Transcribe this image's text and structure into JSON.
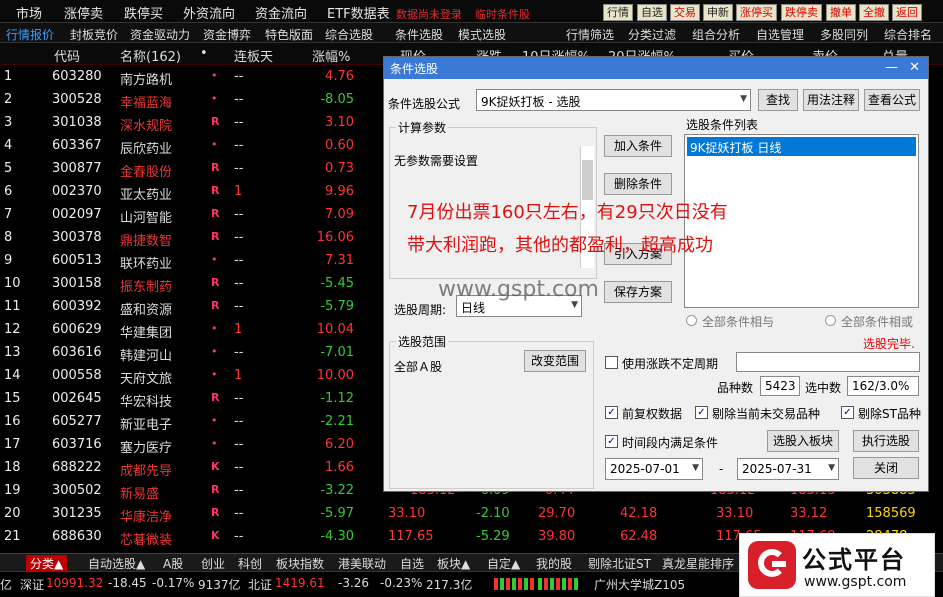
{
  "menubar": {
    "items": [
      "市场",
      "涨停卖",
      "跌停买",
      "外资流向",
      "资金流向",
      "ETF数据表"
    ],
    "login_hint": "数据尚未登录",
    "condition_hint": "临时条件股",
    "buttons": [
      "行情",
      "自选",
      "交易",
      "申新",
      "涨停买",
      "跌停卖",
      "撤单",
      "全撤",
      "返回"
    ]
  },
  "tabs": [
    "行情报价",
    "封板竞价",
    "资金驱动力",
    "资金博弈",
    "特色版面",
    "综合选股",
    "条件选股",
    "模式选股",
    "行情筛选",
    "分类过滤",
    "组合分析",
    "自选管理",
    "多股同列",
    "综合排名"
  ],
  "table": {
    "headers": [
      "代码",
      "名称(162)",
      "•",
      "连板天",
      "涨幅%",
      "现价",
      "涨跌",
      "10日涨幅%",
      "20日涨幅%",
      "买价",
      "卖价",
      "总量"
    ],
    "rows": [
      {
        "i": "1",
        "code": "603280",
        "name": "南方路机",
        "red": false,
        "mk": "•",
        "lb": "--",
        "pct": "4.76",
        "up": true
      },
      {
        "i": "2",
        "code": "300528",
        "name": "幸福蓝海",
        "red": true,
        "mk": "•",
        "lb": "--",
        "pct": "-8.05",
        "up": false
      },
      {
        "i": "3",
        "code": "301038",
        "name": "深水规院",
        "red": true,
        "mk": "R",
        "lb": "--",
        "pct": "3.10",
        "up": true
      },
      {
        "i": "4",
        "code": "603367",
        "name": "辰欣药业",
        "red": false,
        "mk": "•",
        "lb": "--",
        "pct": "0.60",
        "up": true
      },
      {
        "i": "5",
        "code": "300877",
        "name": "金春股份",
        "red": true,
        "mk": "R",
        "lb": "--",
        "pct": "0.73",
        "up": true
      },
      {
        "i": "6",
        "code": "002370",
        "name": "亚太药业",
        "red": false,
        "mk": "R",
        "lb": "1",
        "pct": "9.96",
        "up": true
      },
      {
        "i": "7",
        "code": "002097",
        "name": "山河智能",
        "red": false,
        "mk": "R",
        "lb": "--",
        "pct": "7.09",
        "up": true
      },
      {
        "i": "8",
        "code": "300378",
        "name": "鼎捷数智",
        "red": true,
        "mk": "R",
        "lb": "--",
        "pct": "16.06",
        "up": true
      },
      {
        "i": "9",
        "code": "600513",
        "name": "联环药业",
        "red": false,
        "mk": "•",
        "lb": "--",
        "pct": "7.31",
        "up": true
      },
      {
        "i": "10",
        "code": "300158",
        "name": "振东制药",
        "red": true,
        "mk": "R",
        "lb": "--",
        "pct": "-5.45",
        "up": false
      },
      {
        "i": "11",
        "code": "600392",
        "name": "盛和资源",
        "red": false,
        "mk": "R",
        "lb": "--",
        "pct": "-5.79",
        "up": false
      },
      {
        "i": "12",
        "code": "600629",
        "name": "华建集团",
        "red": false,
        "mk": "•",
        "lb": "1",
        "pct": "10.04",
        "up": true
      },
      {
        "i": "13",
        "code": "603616",
        "name": "韩建河山",
        "red": false,
        "mk": "•",
        "lb": "--",
        "pct": "-7.01",
        "up": false
      },
      {
        "i": "14",
        "code": "000558",
        "name": "天府文旅",
        "red": false,
        "mk": "•",
        "lb": "1",
        "pct": "10.00",
        "up": true
      },
      {
        "i": "15",
        "code": "002645",
        "name": "华宏科技",
        "red": false,
        "mk": "R",
        "lb": "--",
        "pct": "-1.12",
        "up": false
      },
      {
        "i": "16",
        "code": "605277",
        "name": "新亚电子",
        "red": false,
        "mk": "•",
        "lb": "--",
        "pct": "-2.21",
        "up": false
      },
      {
        "i": "17",
        "code": "603716",
        "name": "塞力医疗",
        "red": false,
        "mk": "•",
        "lb": "--",
        "pct": "6.20",
        "up": true
      },
      {
        "i": "18",
        "code": "688222",
        "name": "成都先导",
        "red": true,
        "mk": "K",
        "lb": "--",
        "pct": "1.66",
        "up": true
      },
      {
        "i": "19",
        "code": "300502",
        "name": "新易盛",
        "red": true,
        "mk": "R",
        "lb": "--",
        "pct": "-3.22",
        "up": false
      },
      {
        "i": "20",
        "code": "301235",
        "name": "华康洁净",
        "red": true,
        "mk": "R",
        "lb": "--",
        "pct": "-5.97",
        "up": false
      },
      {
        "i": "21",
        "code": "688630",
        "name": "芯碁微装",
        "red": true,
        "mk": "K",
        "lb": "--",
        "pct": "-4.30",
        "up": false
      }
    ],
    "ext": [
      {
        "cols": [
          "183.12",
          "-6.09",
          "0.44",
          "183.12",
          "183.13",
          "303883"
        ],
        "row": 19
      },
      {
        "cols": [
          "33.10",
          "-2.10",
          "29.70",
          "42.18",
          "33.10",
          "33.12",
          "158569"
        ],
        "row": 20
      },
      {
        "cols": [
          "117.65",
          "-5.29",
          "39.80",
          "62.48",
          "117.65",
          "117.69",
          "28478"
        ],
        "row": 21
      }
    ]
  },
  "dialog": {
    "title": "条件选股",
    "formula_label": "条件选股公式",
    "formula_value": "9K捉妖打板 - 选股",
    "btn_find": "查找",
    "btn_usage": "用法注释",
    "btn_view": "查看公式",
    "params_title": "计算参数",
    "params_text": "无参数需要设置",
    "btn_add": "加入条件",
    "btn_delete": "删除条件",
    "btn_import": "引入方案",
    "btn_save": "保存方案",
    "list_title": "选股条件列表",
    "list_item": "9K捉妖打板  日线",
    "period_label": "选股周期:",
    "period_value": "日线",
    "radio_and": "全部条件相与",
    "radio_or": "全部条件相或",
    "status": "选股完毕.",
    "range_title": "选股范围",
    "range_value": "全部Ａ股",
    "btn_range": "改变范围",
    "chk_uncertain": "使用涨跌不定周期",
    "count_label": "品种数",
    "count_value": "5423",
    "selected_label": "选中数",
    "selected_value": "162/3.0%",
    "chk_adjust": "前复权数据",
    "chk_untraded": "剔除当前未交易品种",
    "chk_st": "剔除ST品种",
    "chk_time": "时间段内满足条件",
    "btn_board": "选股入板块",
    "btn_exec": "执行选股",
    "date_from": "2025-07-01",
    "date_sep": "-",
    "date_to": "2025-07-31",
    "btn_close": "关闭"
  },
  "overlay": {
    "line1": "7月份出票160只左右，有29只次日没有",
    "line2": "带大利润跑，其他的都盈利，超高成功"
  },
  "watermark": "www.gspt.com",
  "bottombar": [
    "分类▲",
    "自动选股▲",
    "A股",
    "创业",
    "科创",
    "板块指数",
    "港美联动",
    "自选",
    "板块▲",
    "自定▲",
    "我的股",
    "剔除北证ST",
    "真龙星能排序"
  ],
  "status": {
    "pre": "亿",
    "sz_label": "深证",
    "sz_val": "10991.32",
    "sz_chg": "-18.45",
    "sz_pct": "-0.17%",
    "sz_vol": "9137亿",
    "bz_label": "北证",
    "bz_val": "1419.61",
    "bz_chg": "-3.26",
    "bz_pct": "-0.23%",
    "bz_vol": "217.3亿",
    "location": "广州大学城Z105"
  },
  "logo": {
    "title": "公式平台",
    "url": "www.gspt.com"
  }
}
